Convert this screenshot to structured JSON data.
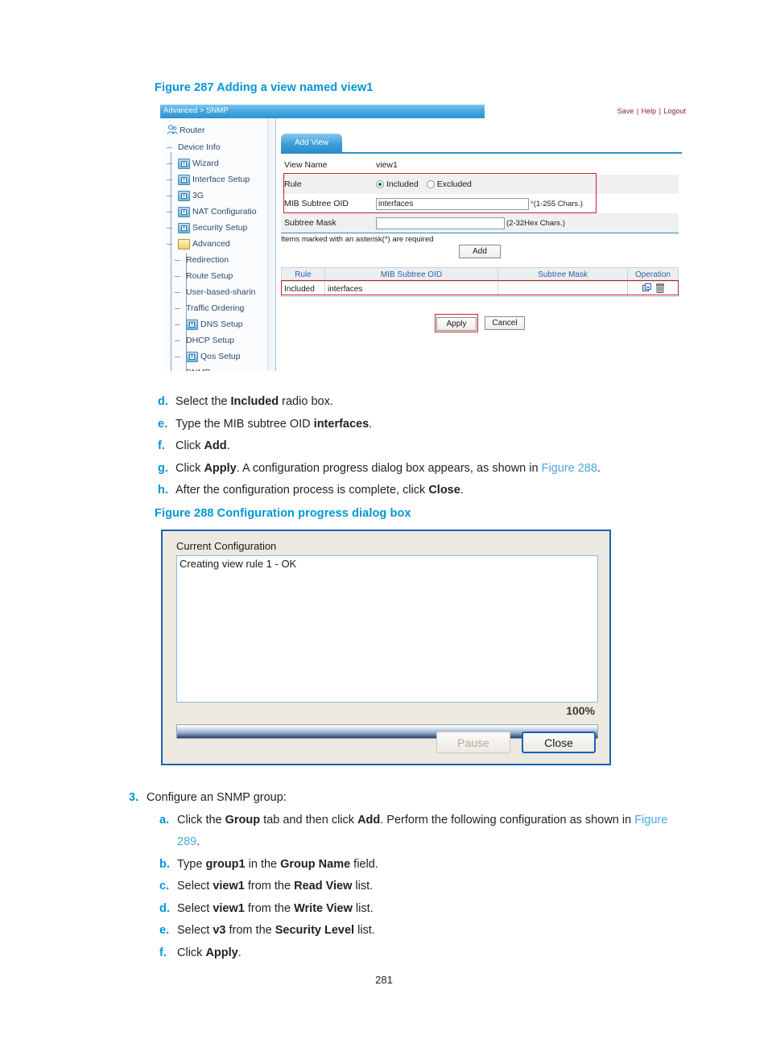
{
  "figure287": {
    "caption": "Figure 287 Adding a view named view1",
    "breadcrumb": "Advanced > SNMP",
    "header_links": [
      "Save",
      "Help",
      "Logout"
    ],
    "sidebar": {
      "root": "Router",
      "items": [
        {
          "label": "Device Info",
          "icon": "none",
          "level": 1
        },
        {
          "label": "Wizard",
          "icon": "folder-closed-icon",
          "level": 1
        },
        {
          "label": "Interface Setup",
          "icon": "folder-closed-icon",
          "level": 1
        },
        {
          "label": "3G",
          "icon": "folder-closed-icon",
          "level": 1
        },
        {
          "label": "NAT Configuratio",
          "icon": "folder-closed-icon",
          "level": 1
        },
        {
          "label": "Security Setup",
          "icon": "folder-closed-icon",
          "level": 1
        },
        {
          "label": "Advanced",
          "icon": "folder-open-icon",
          "level": 1
        },
        {
          "label": "Redirection",
          "icon": "none",
          "level": 2
        },
        {
          "label": "Route Setup",
          "icon": "none",
          "level": 2
        },
        {
          "label": "User-based-sharin",
          "icon": "none",
          "level": 2
        },
        {
          "label": "Traffic Ordering",
          "icon": "none",
          "level": 2
        },
        {
          "label": "DNS Setup",
          "icon": "folder-closed-icon",
          "level": 2
        },
        {
          "label": "DHCP Setup",
          "icon": "none",
          "level": 2
        },
        {
          "label": "Qos Setup",
          "icon": "folder-closed-icon",
          "level": 2
        },
        {
          "label": "SNMP",
          "icon": "none",
          "level": 2
        }
      ]
    },
    "tab": "Add View",
    "form": {
      "view_name_label": "View Name",
      "view_name_value": "view1",
      "rule_label": "Rule",
      "rule_options": [
        "Included",
        "Excluded"
      ],
      "rule_selected": "Included",
      "oid_label": "MIB Subtree OID",
      "oid_value": "interfaces",
      "oid_hint": "(1-255 Chars.)",
      "oid_star": "*",
      "mask_label": "Subtree Mask",
      "mask_value": "",
      "mask_hint": "(2-32Hex Chars.)",
      "required_note": "Items marked with an asterisk(*) are required",
      "add_button": "Add"
    },
    "table": {
      "headers": [
        "Rule",
        "MIB Subtree OID",
        "Subtree Mask",
        "Operation"
      ],
      "rows": [
        {
          "rule": "Included",
          "oid": "interfaces",
          "mask": "",
          "operation_icons": [
            "edit-icon",
            "delete-icon"
          ]
        }
      ]
    },
    "buttons": {
      "apply": "Apply",
      "cancel": "Cancel"
    }
  },
  "steps_group_2": [
    {
      "marker": "d.",
      "parts": [
        {
          "t": "Select the ",
          "b": false
        },
        {
          "t": "Included",
          "b": true
        },
        {
          "t": " radio box.",
          "b": false
        }
      ]
    },
    {
      "marker": "e.",
      "parts": [
        {
          "t": "Type the MIB subtree OID ",
          "b": false
        },
        {
          "t": "interfaces",
          "b": true
        },
        {
          "t": ".",
          "b": false
        }
      ]
    },
    {
      "marker": "f.",
      "parts": [
        {
          "t": "Click ",
          "b": false
        },
        {
          "t": "Add",
          "b": true
        },
        {
          "t": ".",
          "b": false
        }
      ]
    },
    {
      "marker": "g.",
      "parts": [
        {
          "t": "Click ",
          "b": false
        },
        {
          "t": "Apply",
          "b": true
        },
        {
          "t": ". A configuration progress dialog box appears, as shown in ",
          "b": false
        },
        {
          "t": "Figure 288",
          "b": false,
          "x": true
        },
        {
          "t": ".",
          "b": false
        }
      ]
    },
    {
      "marker": "h.",
      "parts": [
        {
          "t": "After the configuration process is complete, click ",
          "b": false
        },
        {
          "t": "Close",
          "b": true
        },
        {
          "t": ".",
          "b": false
        }
      ]
    }
  ],
  "figure288": {
    "caption": "Figure 288 Configuration progress dialog box",
    "title": "Current Configuration",
    "log_text": "Creating view rule 1 - OK",
    "percent": "100%",
    "progress_value": 100,
    "pause_button": "Pause",
    "close_button": "Close"
  },
  "step3": {
    "marker": "3.",
    "text": "Configure an SNMP group:",
    "substeps": [
      {
        "marker": "a.",
        "parts": [
          {
            "t": "Click the ",
            "b": false
          },
          {
            "t": "Group",
            "b": true
          },
          {
            "t": " tab and then click ",
            "b": false
          },
          {
            "t": "Add",
            "b": true
          },
          {
            "t": ". Perform the following configuration as shown in ",
            "b": false
          },
          {
            "t": "Figure 289",
            "b": false,
            "x": true
          },
          {
            "t": ".",
            "b": false
          }
        ]
      },
      {
        "marker": "b.",
        "parts": [
          {
            "t": "Type ",
            "b": false
          },
          {
            "t": "group1",
            "b": true
          },
          {
            "t": " in the ",
            "b": false
          },
          {
            "t": "Group Name",
            "b": true
          },
          {
            "t": " field.",
            "b": false
          }
        ]
      },
      {
        "marker": "c.",
        "parts": [
          {
            "t": "Select ",
            "b": false
          },
          {
            "t": "view1",
            "b": true
          },
          {
            "t": " from the ",
            "b": false
          },
          {
            "t": "Read View",
            "b": true
          },
          {
            "t": " list.",
            "b": false
          }
        ]
      },
      {
        "marker": "d.",
        "parts": [
          {
            "t": "Select ",
            "b": false
          },
          {
            "t": "view1",
            "b": true
          },
          {
            "t": " from the ",
            "b": false
          },
          {
            "t": "Write View",
            "b": true
          },
          {
            "t": " list.",
            "b": false
          }
        ]
      },
      {
        "marker": "e.",
        "parts": [
          {
            "t": "Select ",
            "b": false
          },
          {
            "t": "v3",
            "b": true
          },
          {
            "t": " from the ",
            "b": false
          },
          {
            "t": "Security Level",
            "b": true
          },
          {
            "t": " list.",
            "b": false
          }
        ]
      },
      {
        "marker": "f.",
        "parts": [
          {
            "t": "Click ",
            "b": false
          },
          {
            "t": "Apply",
            "b": true
          },
          {
            "t": ".",
            "b": false
          }
        ]
      }
    ]
  },
  "page_number": "281"
}
